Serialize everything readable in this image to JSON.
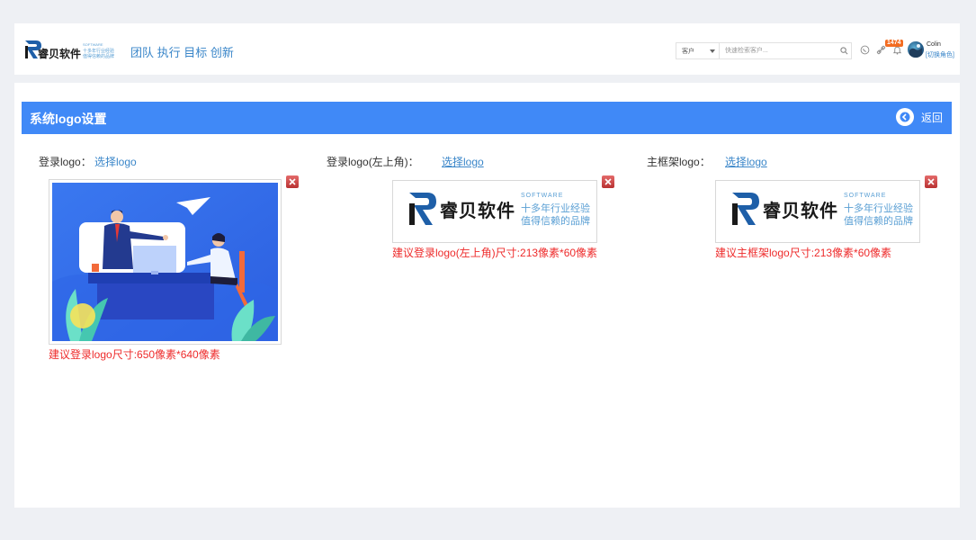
{
  "header": {
    "logo_text": "睿贝软件",
    "logo_software": "SOFTWARE",
    "logo_tagline_1": "十多年行业经验",
    "logo_tagline_2": "值得信赖的品牌",
    "slogan": "团队 执行 目标 创新",
    "search": {
      "select_value": "客户",
      "placeholder": "快速检索客户..."
    },
    "notification_count": "1474",
    "user_name": "Colin",
    "switch_role": "[切换角色]",
    "icons": [
      "search-icon",
      "whatsapp-icon",
      "link-icon",
      "bell-icon",
      "avatar"
    ]
  },
  "panel": {
    "title": "系统logo设置",
    "back_label": "返回",
    "sections": [
      {
        "label": "登录logo：",
        "choose": "选择logo",
        "hint": "建议登录logo尺寸:650像素*640像素"
      },
      {
        "label": "登录logo(左上角)：",
        "choose": "选择logo",
        "hint": "建议登录logo(左上角)尺寸:213像素*60像素"
      },
      {
        "label": "主框架logo：",
        "choose": "选择logo",
        "hint": "建议主框架logo尺寸:213像素*60像素"
      }
    ]
  },
  "colors": {
    "accent": "#4089f7",
    "link": "#3a86c9",
    "hint": "#ee2b2b",
    "background": "#eef0f4"
  }
}
